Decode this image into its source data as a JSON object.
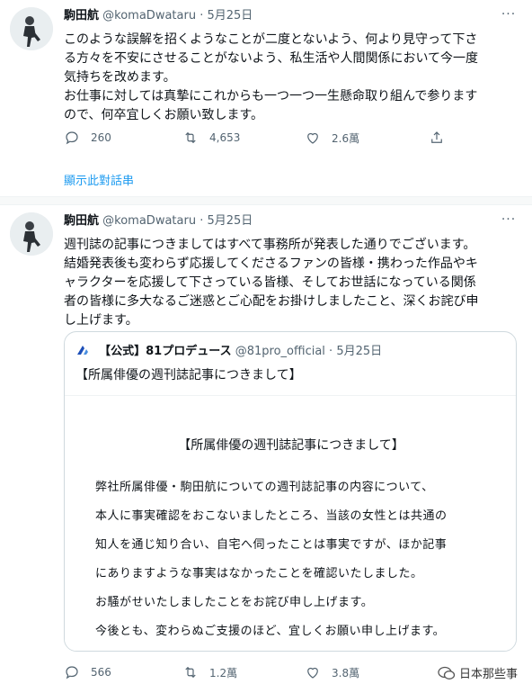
{
  "tweet1": {
    "name": "駒田航",
    "handle": "@komaDwataru",
    "dot": "·",
    "date": "5月25日",
    "lines": [
      "このような誤解を招くようなことが二度とないよう、何より見守って下さ",
      "る方々を不安にさせることがないよう、私生活や人間関係において今一度",
      "気持ちを改めます。",
      "お仕事に対しては真摯にこれからも一つ一つ一生懸命取り組んで参ります",
      "ので、何卒宜しくお願い致します。"
    ],
    "replies": "260",
    "retweets": "4,653",
    "likes": "2.6萬",
    "thread_link": "顯示此對話串"
  },
  "tweet2": {
    "name": "駒田航",
    "handle": "@komaDwataru",
    "dot": "·",
    "date": "5月25日",
    "lines": [
      "週刊誌の記事につきましてはすべて事務所が発表した通りでございます。",
      "結婚発表後も変わらず応援してくださるファンの皆様・携わった作品やキ",
      "ャラクターを応援して下さっている皆様、そしてお世話になっている関係",
      "者の皆様に多大なるご迷惑とご心配をお掛けしましたこと、深くお詫び申",
      "し上げます。"
    ],
    "quote": {
      "name": "【公式】81プロデュース",
      "handle": "@81pro_official",
      "dot": "·",
      "date": "5月25日",
      "text": "【所属俳優の週刊誌記事につきまして】",
      "doc_title": "【所属俳優の週刊誌記事につきまして】",
      "doc_lines": [
        "弊社所属俳優・駒田航についての週刊誌記事の内容について、",
        "本人に事実確認をおこないましたところ、当該の女性とは共通の",
        "知人を通じ知り合い、自宅へ伺ったことは事実ですが、ほか記事",
        "にありますような事実はなかったことを確認いたしました。",
        "お騒がせいたしましたことをお詫び申し上げます。",
        "今後とも、変わらぬご支援のほど、宜しくお願い申し上げます。"
      ]
    },
    "replies": "566",
    "retweets": "1.2萬",
    "likes": "3.8萬"
  },
  "watermark": "日本那些事",
  "colors": {
    "text": "#0f1419",
    "muted": "#536471",
    "link": "#1d9bf0",
    "border": "#cfd9de"
  }
}
